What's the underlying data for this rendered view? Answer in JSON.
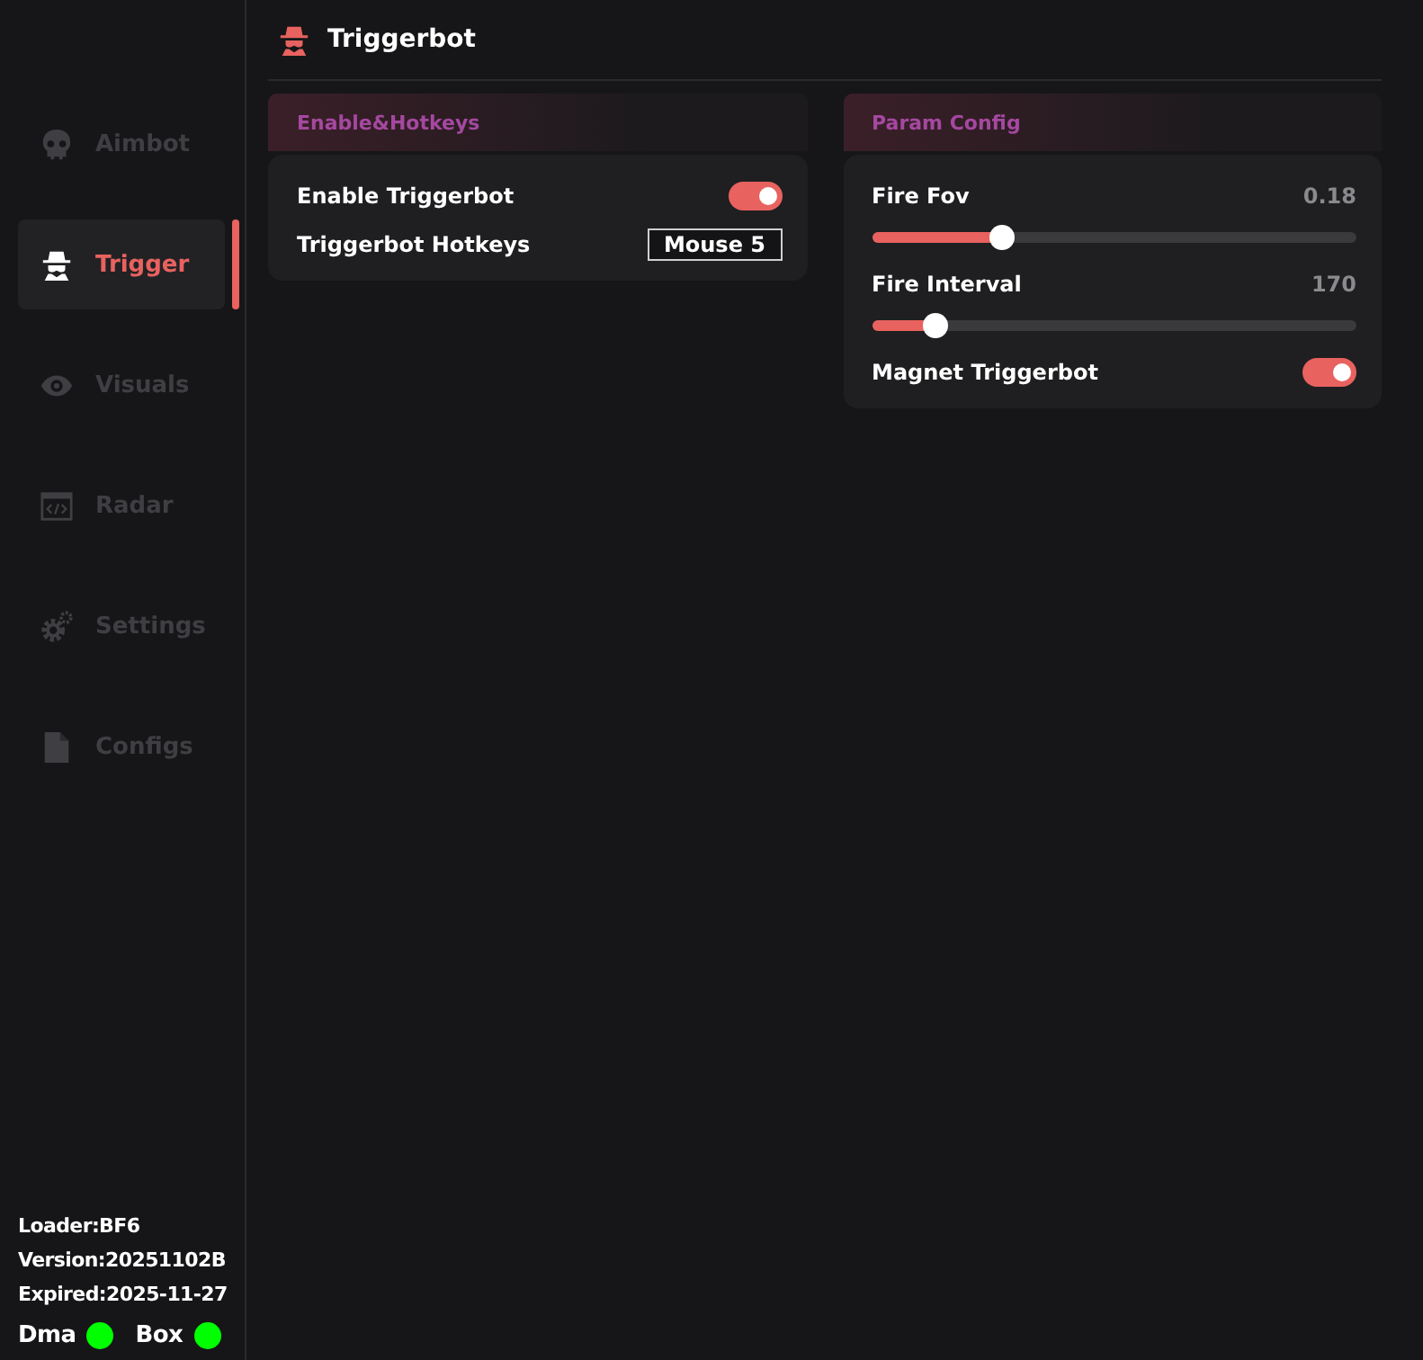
{
  "header": {
    "title": "Triggerbot"
  },
  "sidebar": {
    "items": [
      {
        "label": "Aimbot",
        "selected": false
      },
      {
        "label": "Trigger",
        "selected": true
      },
      {
        "label": "Visuals",
        "selected": false
      },
      {
        "label": "Radar",
        "selected": false
      },
      {
        "label": "Settings",
        "selected": false
      },
      {
        "label": "Configs",
        "selected": false
      }
    ],
    "info": [
      "Loader:BF6",
      "Version:20251102B",
      "Expired:2025-11-27"
    ],
    "status": [
      {
        "label": "Dma",
        "on": true
      },
      {
        "label": "Box",
        "on": true
      }
    ]
  },
  "panels": [
    {
      "title": "Enable&Hotkeys",
      "rows": [
        {
          "kind": "toggle",
          "label": "Enable Triggerbot",
          "on": true
        },
        {
          "kind": "hotkey",
          "label": "Triggerbot Hotkeys",
          "value": "Mouse 5"
        }
      ]
    },
    {
      "title": "Param Config",
      "rows": [
        {
          "kind": "slider",
          "label": "Fire Fov",
          "reading": "0.18",
          "level": 0.27
        },
        {
          "kind": "slider",
          "label": "Fire Interval",
          "reading": "170",
          "level": 0.13
        },
        {
          "kind": "toggle",
          "label": "Magnet Triggerbot",
          "on": true
        }
      ]
    }
  ]
}
